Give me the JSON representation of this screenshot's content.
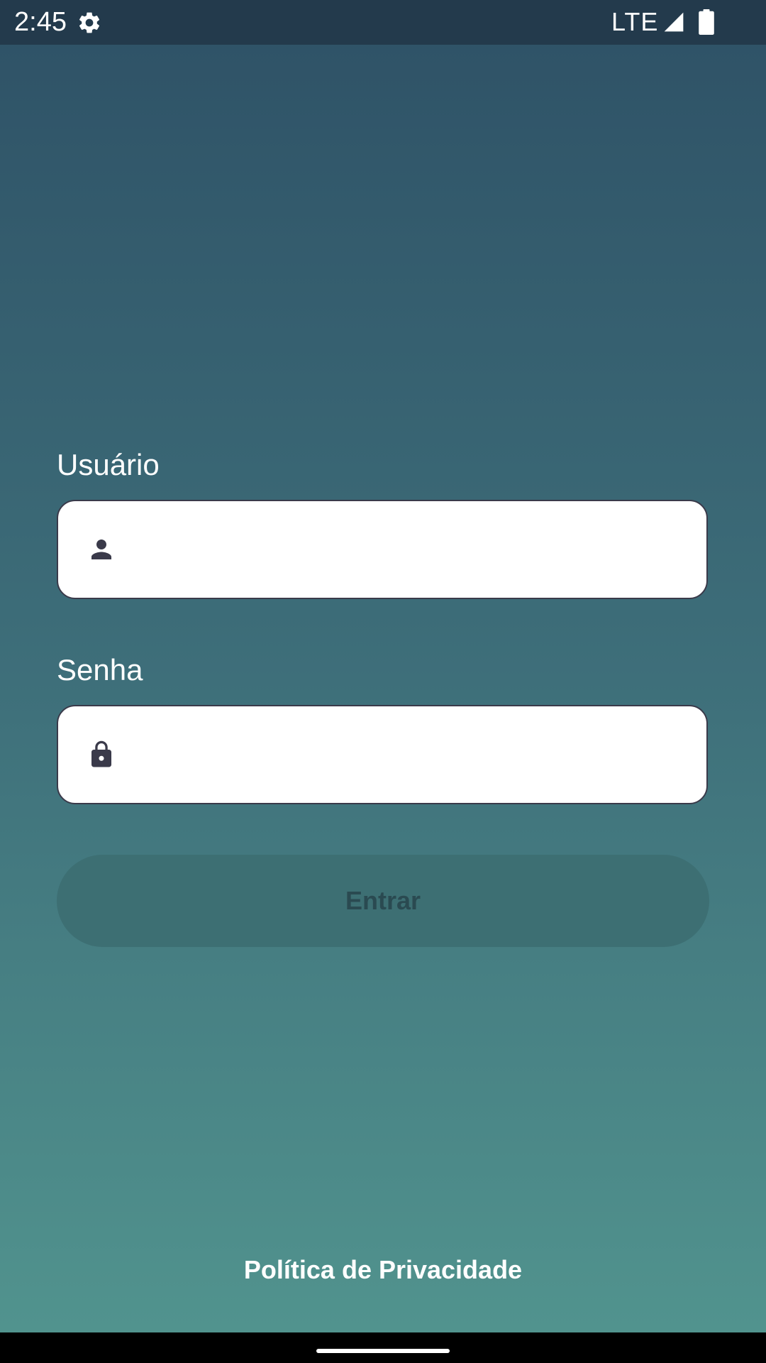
{
  "status_bar": {
    "time": "2:45",
    "network": "LTE",
    "icons": [
      "gear-icon",
      "signal-icon",
      "battery-icon"
    ]
  },
  "form": {
    "username": {
      "label": "Usuário",
      "value": "",
      "icon": "person-icon"
    },
    "password": {
      "label": "Senha",
      "value": "",
      "icon": "lock-icon"
    },
    "submit_label": "Entrar"
  },
  "footer": {
    "privacy_link": "Política de Privacidade"
  },
  "colors": {
    "gradient_top": "#2e5166",
    "gradient_bottom": "#52958f",
    "status_bar": "#233a4c",
    "field_background": "#ffffff",
    "icon_color": "#3a3a4a"
  }
}
